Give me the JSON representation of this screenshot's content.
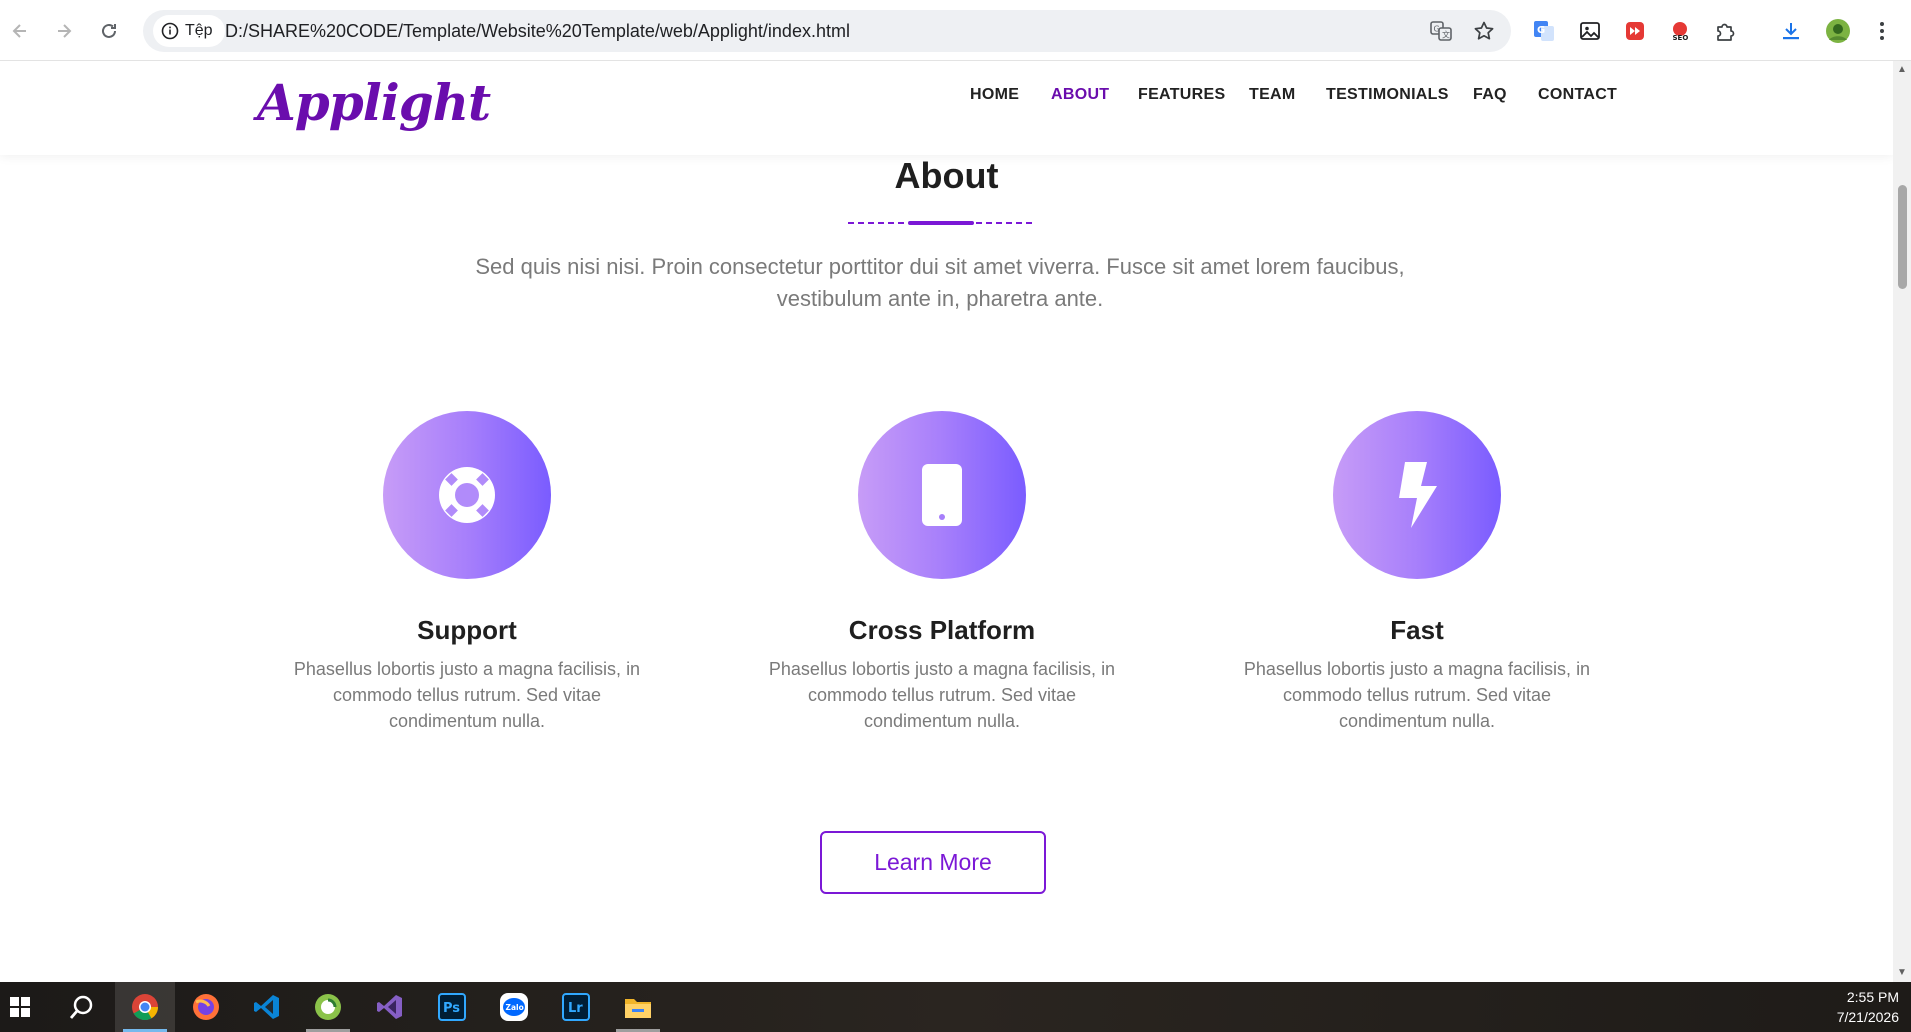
{
  "browser": {
    "site_info_label": "Tệp",
    "url": "D:/SHARE%20CODE/Template/Website%20Template/web/Applight/index.html"
  },
  "header": {
    "logo": "Applight",
    "menu": [
      {
        "label": "HOME",
        "active": false
      },
      {
        "label": "ABOUT",
        "active": true
      },
      {
        "label": "FEATURES",
        "active": false
      },
      {
        "label": "TEAM",
        "active": false
      },
      {
        "label": "TESTIMONIALS",
        "active": false
      },
      {
        "label": "FAQ",
        "active": false
      },
      {
        "label": "CONTACT",
        "active": false
      }
    ]
  },
  "about": {
    "title": "About",
    "lead": "Sed quis nisi nisi. Proin consectetur porttitor dui sit amet viverra. Fusce sit amet lorem faucibus, vestibulum ante in, pharetra ante.",
    "features": [
      {
        "icon": "lifebuoy-icon",
        "title": "Support",
        "text": "Phasellus lobortis justo a magna facilisis, in commodo tellus rutrum. Sed vitae condimentum nulla."
      },
      {
        "icon": "mobile-icon",
        "title": "Cross Platform",
        "text": "Phasellus lobortis justo a magna facilisis, in commodo tellus rutrum. Sed vitae condimentum nulla."
      },
      {
        "icon": "bolt-icon",
        "title": "Fast",
        "text": "Phasellus lobortis justo a magna facilisis, in commodo tellus rutrum. Sed vitae condimentum nulla."
      }
    ],
    "button_label": "Learn More"
  },
  "colors": {
    "brand": "#6a0dad",
    "button": "#7b18d6",
    "gradient_start": "#c79cf7",
    "gradient_end": "#7a5cff"
  },
  "taskbar": {
    "time": "2:55 PM",
    "date": "7/21/2026",
    "apps": [
      "windows-start-icon",
      "search-icon",
      "chrome-icon",
      "firefox-icon",
      "vscode-icon",
      "coccoc-icon",
      "visual-studio-icon",
      "photoshop-icon",
      "zalo-icon",
      "lightroom-icon",
      "file-explorer-icon"
    ],
    "ps_label": "Ps",
    "lr_label": "Lr",
    "zalo_label": "Zalo"
  }
}
